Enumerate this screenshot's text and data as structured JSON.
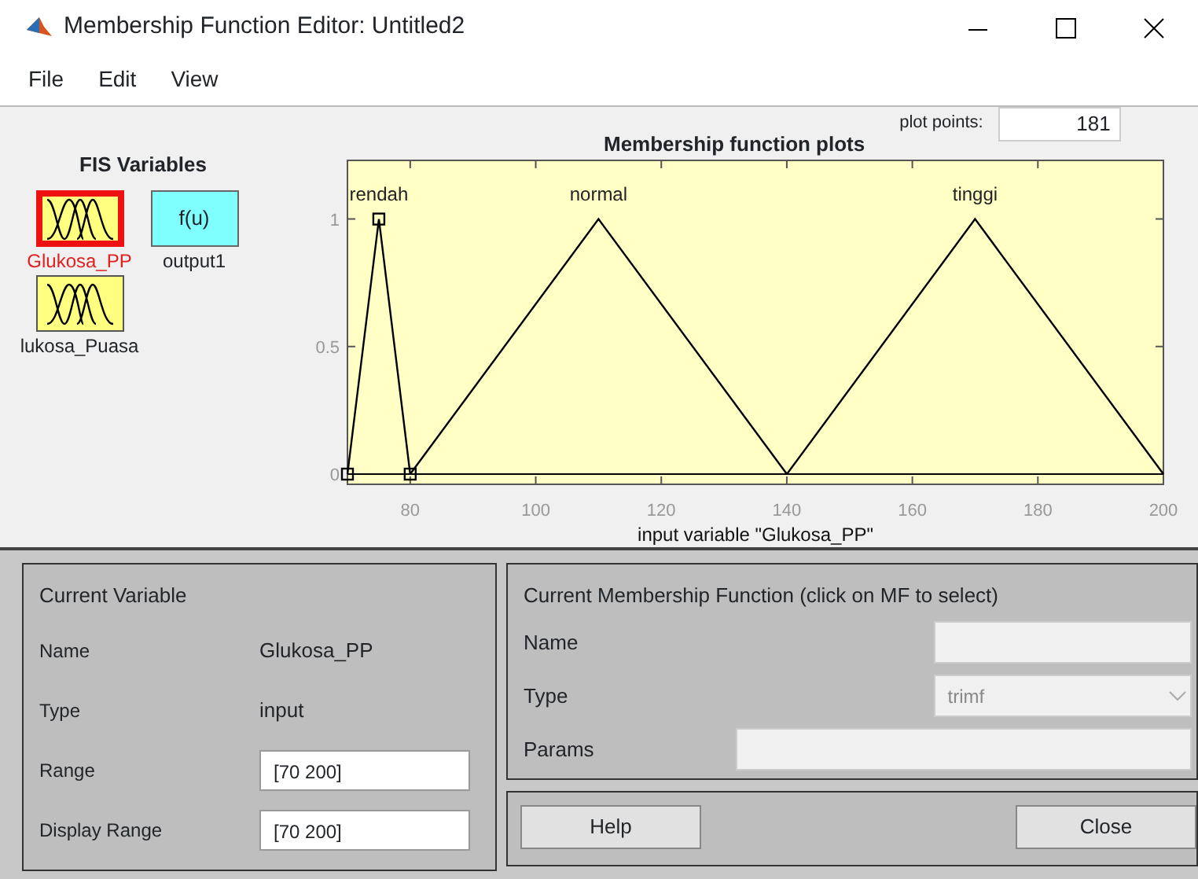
{
  "window": {
    "title": "Membership Function Editor: Untitled2"
  },
  "menu": [
    "File",
    "Edit",
    "View"
  ],
  "fis_variables": {
    "title": "FIS Variables",
    "items": [
      {
        "name": "Glukosa_PP",
        "kind": "input",
        "selected": true
      },
      {
        "name": "output1",
        "kind": "output",
        "selected": false,
        "symbol": "f(u)"
      },
      {
        "name": "lukosa_Puasa",
        "kind": "input",
        "selected": false
      }
    ]
  },
  "plot": {
    "title": "Membership function plots",
    "plot_points_label": "plot points:",
    "plot_points": "181",
    "chart_data": {
      "type": "line",
      "xlabel": "input variable \"Glukosa_PP\"",
      "x": [
        70,
        75,
        80,
        110,
        140,
        170,
        200
      ],
      "series": [
        {
          "name": "rendah",
          "color": "#000000",
          "marker": "square",
          "values": [
            0,
            1,
            0,
            null,
            null,
            null,
            null
          ]
        },
        {
          "name": "normal",
          "color": "#000000",
          "values": [
            null,
            null,
            0,
            1,
            0,
            null,
            null
          ]
        },
        {
          "name": "tinggi",
          "color": "#000000",
          "values": [
            null,
            null,
            null,
            null,
            0,
            1,
            0
          ]
        }
      ],
      "xlim": [
        70,
        200
      ],
      "ylim": [
        -0.04,
        1.23
      ],
      "xticks": [
        80,
        100,
        120,
        140,
        160,
        180,
        200
      ],
      "yticks": [
        0,
        0.5,
        1
      ]
    }
  },
  "current_variable": {
    "title": "Current Variable",
    "rows": [
      {
        "label": "Name",
        "kind": "text",
        "value": "Glukosa_PP"
      },
      {
        "label": "Type",
        "kind": "text",
        "value": "input"
      },
      {
        "label": "Range",
        "kind": "field",
        "value": "[70 200]"
      },
      {
        "label": "Display Range",
        "kind": "field",
        "value": "[70 200]"
      }
    ]
  },
  "current_mf": {
    "title": "Current Membership Function (click on MF to select)",
    "rows": [
      {
        "label": "Name",
        "kind": "field",
        "value": "",
        "disabled": true
      },
      {
        "label": "Type",
        "kind": "select",
        "value": "trimf",
        "disabled": true
      },
      {
        "label": "Params",
        "kind": "wide",
        "value": "",
        "disabled": true
      }
    ]
  },
  "buttons": [
    "Help",
    "Close"
  ]
}
